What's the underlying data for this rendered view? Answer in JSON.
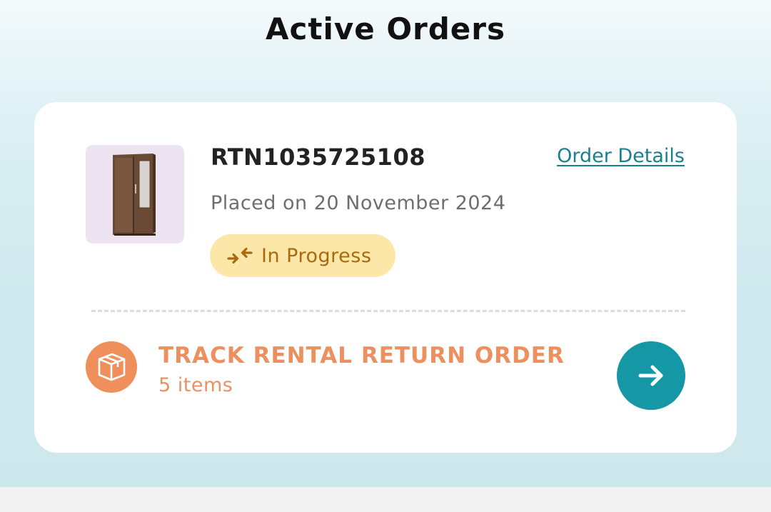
{
  "page": {
    "title": "Active Orders"
  },
  "order": {
    "id": "RTN1035725108",
    "details_link": "Order Details",
    "placed_text": "Placed on 20 November 2024",
    "status": "In Progress",
    "status_icon": "arrows-converge-icon",
    "thumbnail": "wardrobe-image"
  },
  "tracking": {
    "title": "TRACK RENTAL RETURN ORDER",
    "count": "5 items",
    "icon": "package-box-icon",
    "action_icon": "arrow-right-icon"
  },
  "colors": {
    "accent": "#1597a6",
    "link": "#1a7f90",
    "orange": "#ec9060",
    "status_bg": "#fde7a8",
    "status_text": "#a86a10"
  }
}
